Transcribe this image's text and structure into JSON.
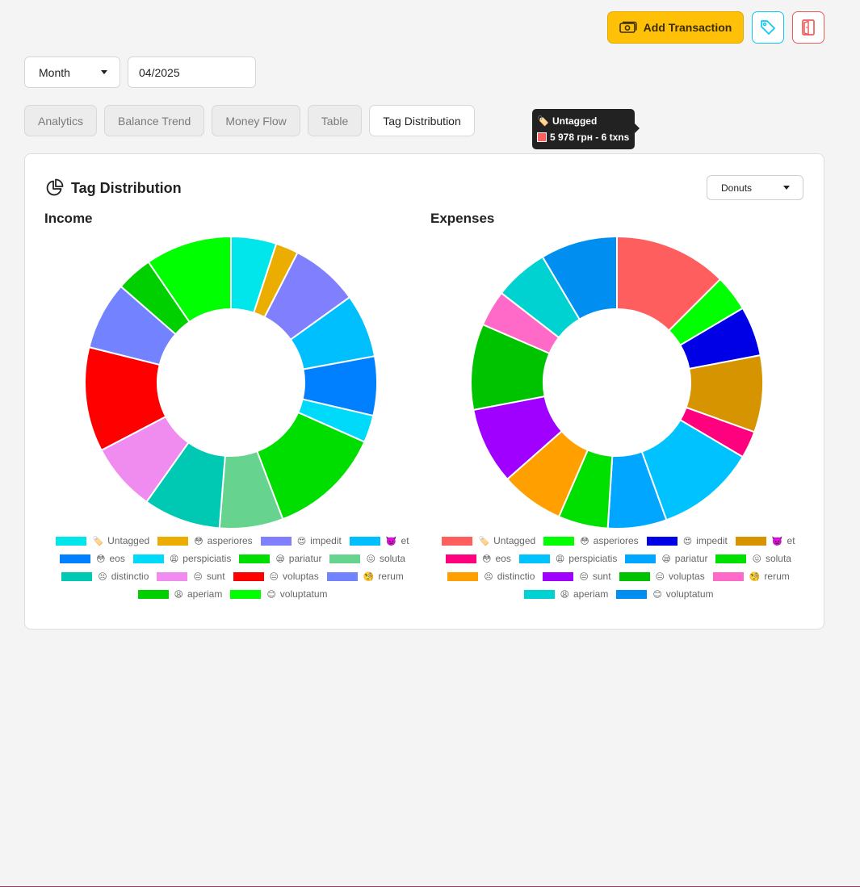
{
  "header": {
    "add_transaction_label": "Add Transaction",
    "tags_button_icon": "tag-icon",
    "exit_button_icon": "door-exit-icon"
  },
  "filters": {
    "period_select": "Month",
    "date_value": "04/2025"
  },
  "tabs": [
    {
      "label": "Analytics",
      "active": false
    },
    {
      "label": "Balance Trend",
      "active": false
    },
    {
      "label": "Money Flow",
      "active": false
    },
    {
      "label": "Table",
      "active": false
    },
    {
      "label": "Tag Distribution",
      "active": true
    }
  ],
  "card": {
    "title": "Tag Distribution",
    "title_icon": "pie-chart-icon",
    "chart_type_select": "Donuts"
  },
  "tooltip": {
    "emoji": "🏷️",
    "title": "Untagged",
    "value": "5 978 грн - 6 txns",
    "color": "#ff5e5e"
  },
  "chart_data": [
    {
      "type": "pie",
      "title": "Income",
      "donut": true,
      "slices": [
        {
          "emoji": "🏷️",
          "label": "Untagged",
          "value": 5.0,
          "color": "#00e6ea"
        },
        {
          "emoji": "😳",
          "label": "asperiores",
          "value": 2.5,
          "color": "#eaad00"
        },
        {
          "emoji": "😍",
          "label": "impedit",
          "value": 7.5,
          "color": "#8080ff"
        },
        {
          "emoji": "👿",
          "label": "et",
          "value": 7.0,
          "color": "#00bfff"
        },
        {
          "emoji": "😳",
          "label": "eos",
          "value": 6.5,
          "color": "#0080ff"
        },
        {
          "emoji": "😩",
          "label": "perspiciatis",
          "value": 3.0,
          "color": "#00dafa"
        },
        {
          "emoji": "😪",
          "label": "pariatur",
          "value": 12.5,
          "color": "#00de00"
        },
        {
          "emoji": "😖",
          "label": "soluta",
          "value": 7.0,
          "color": "#66d48f"
        },
        {
          "emoji": "😣",
          "label": "distinctio",
          "value": 8.5,
          "color": "#00c9b3"
        },
        {
          "emoji": "😔",
          "label": "sunt",
          "value": 7.5,
          "color": "#f08cf0"
        },
        {
          "emoji": "😑",
          "label": "voluptas",
          "value": 11.5,
          "color": "#ff0000"
        },
        {
          "emoji": "🧐",
          "label": "rerum",
          "value": 7.5,
          "color": "#7382ff"
        },
        {
          "emoji": "😩",
          "label": "aperiam",
          "value": 4.0,
          "color": "#00cf00"
        },
        {
          "emoji": "😊",
          "label": "voluptatum",
          "value": 9.5,
          "color": "#00ff00"
        }
      ]
    },
    {
      "type": "pie",
      "title": "Expenses",
      "donut": true,
      "slices": [
        {
          "emoji": "🏷️",
          "label": "Untagged",
          "value": 12.5,
          "color": "#ff5e5e"
        },
        {
          "emoji": "😳",
          "label": "asperiores",
          "value": 4.0,
          "color": "#00ff00"
        },
        {
          "emoji": "😍",
          "label": "impedit",
          "value": 5.5,
          "color": "#0000e6"
        },
        {
          "emoji": "👿",
          "label": "et",
          "value": 8.5,
          "color": "#d59400"
        },
        {
          "emoji": "😳",
          "label": "eos",
          "value": 3.0,
          "color": "#ff007f"
        },
        {
          "emoji": "😩",
          "label": "perspiciatis",
          "value": 11.0,
          "color": "#00c2ff"
        },
        {
          "emoji": "😪",
          "label": "pariatur",
          "value": 6.5,
          "color": "#00a6ff"
        },
        {
          "emoji": "😖",
          "label": "soluta",
          "value": 5.5,
          "color": "#00e000"
        },
        {
          "emoji": "😣",
          "label": "distinctio",
          "value": 7.0,
          "color": "#ff9f00"
        },
        {
          "emoji": "😔",
          "label": "sunt",
          "value": 8.5,
          "color": "#a000ff"
        },
        {
          "emoji": "😑",
          "label": "voluptas",
          "value": 9.5,
          "color": "#00c300"
        },
        {
          "emoji": "🧐",
          "label": "rerum",
          "value": 4.0,
          "color": "#ff69c8"
        },
        {
          "emoji": "😩",
          "label": "aperiam",
          "value": 6.0,
          "color": "#00d2d2"
        },
        {
          "emoji": "😊",
          "label": "voluptatum",
          "value": 8.5,
          "color": "#008ff0"
        }
      ]
    }
  ]
}
